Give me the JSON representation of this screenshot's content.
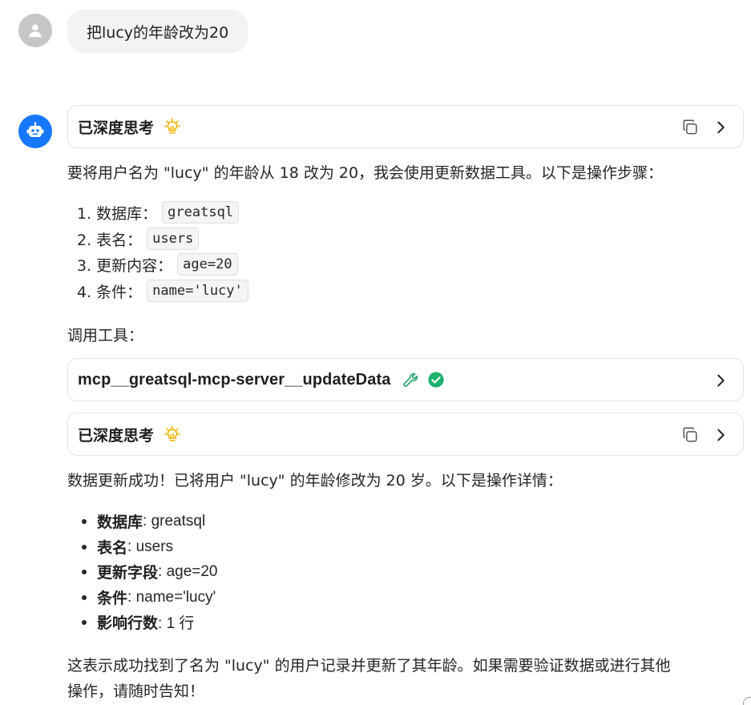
{
  "user_message": "把lucy的年龄改为20",
  "thinking_label": "已深度思考",
  "intro_text": "要将用户名为 \"lucy\" 的年龄从 18 改为 20，我会使用更新数据工具。以下是操作步骤：",
  "steps": [
    {
      "label": "1. 数据库：",
      "code": "greatsql"
    },
    {
      "label": "2. 表名：",
      "code": "users"
    },
    {
      "label": "3. 更新内容：",
      "code": "age=20"
    },
    {
      "label": "4. 条件：",
      "code": "name='lucy'"
    }
  ],
  "tool_call_label": "调用工具：",
  "tool_name": "mcp__greatsql-mcp-server__updateData",
  "thinking_label_2": "已深度思考",
  "result_text": "数据更新成功！已将用户 \"lucy\" 的年龄修改为 20 岁。以下是操作详情：",
  "details": [
    {
      "key": "数据库",
      "value": ": greatsql"
    },
    {
      "key": "表名",
      "value": ": users"
    },
    {
      "key": "更新字段",
      "value": ": age=20"
    },
    {
      "key": "条件",
      "value": ": name='lucy'"
    },
    {
      "key": "影响行数",
      "value": ": 1 行"
    }
  ],
  "closing_line_1": "这表示成功找到了名为 \"lucy\" 的用户记录并更新了其年龄。如果需要验证数据或进行其他",
  "closing_line_2": "操作，请随时告知！",
  "colors": {
    "bot_avatar": "#1677ff",
    "user_avatar": "#c6c6c6",
    "bulb": "#f5b400",
    "wrench": "#22a06b",
    "success": "#19b36b"
  },
  "icons": {
    "user_avatar": "person-icon",
    "bot_avatar": "robot-icon",
    "bulb": "lightbulb-icon",
    "copy": "copy-icon",
    "chevron": "chevron-right-icon",
    "wrench": "wrench-icon",
    "success": "check-circle-icon"
  }
}
